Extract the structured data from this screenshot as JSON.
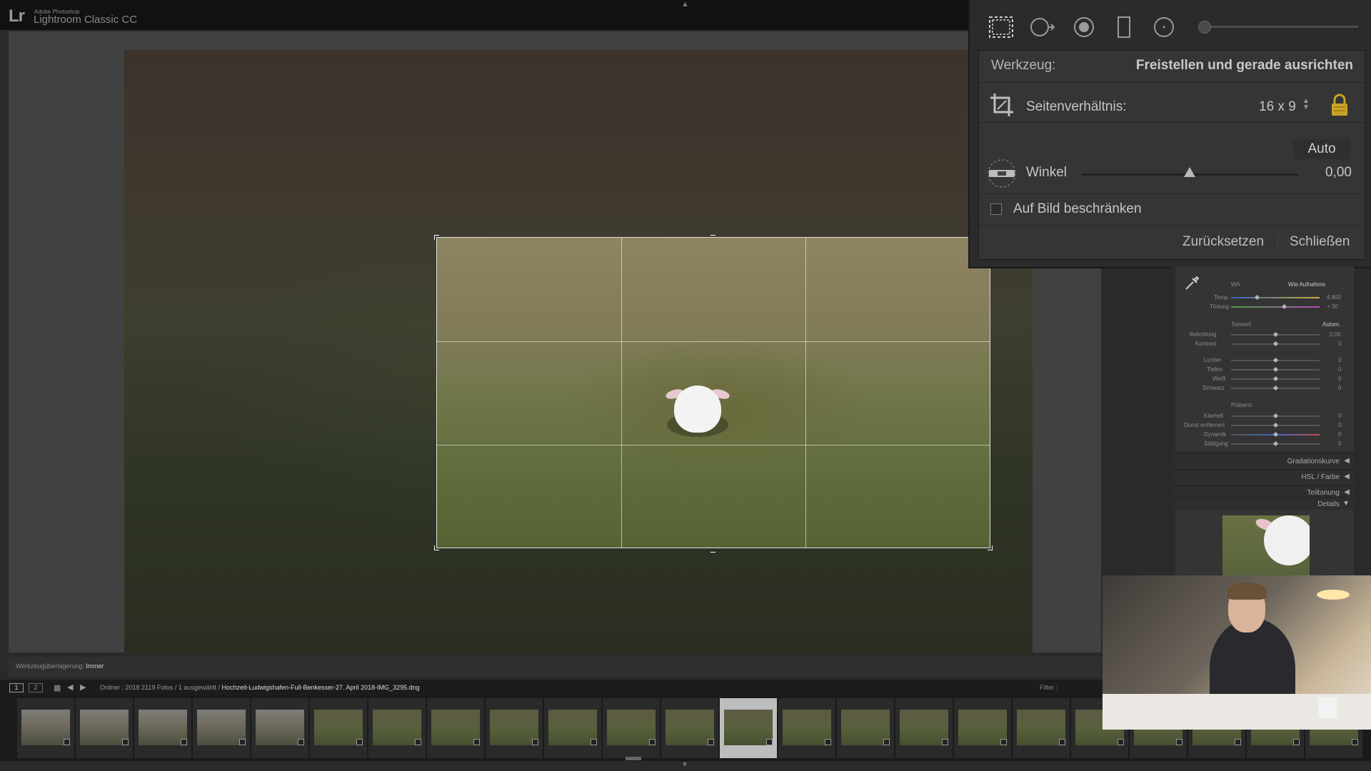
{
  "app": {
    "logo": "Lr",
    "brand_small": "Adobe Photoshop",
    "brand_name": "Lightroom Classic CC"
  },
  "icons": {
    "top_arrow": "▲",
    "bottom_arrow": "▼",
    "rotate_cursor": "⤧",
    "grid": "▦",
    "back": "◀",
    "forward": "▶"
  },
  "crop_tool": {
    "tool_label": "Werkzeug:",
    "tool_value": "Freistellen und gerade ausrichten",
    "aspect_label": "Seitenverhältnis:",
    "aspect_value": "16 x 9",
    "aspect_arrows": "▲\n▼",
    "auto_button": "Auto",
    "angle_label": "Winkel",
    "angle_value": "0,00",
    "constrain_label": "Auf Bild beschränken",
    "reset_button": "Zurücksetzen",
    "close_button": "Schließen",
    "lock_color": "#c9a325"
  },
  "develop": {
    "wb_label": "WA",
    "wb_value": "Wie Aufnahme",
    "temp_label": "Temp.",
    "temp_value": "4.800",
    "tint_label": "Tönung",
    "tint_value": "+ 30",
    "tone_label": "Tonwert",
    "tone_auto": "Autom.",
    "exposure_label": "Belichtung",
    "exposure_value": "0,00",
    "contrast_label": "Kontrast",
    "contrast_value": "0",
    "highlights_label": "Lichter",
    "highlights_value": "0",
    "shadows_label": "Tiefen",
    "shadows_value": "0",
    "whites_label": "Weiß",
    "whites_value": "0",
    "blacks_label": "Schwarz",
    "blacks_value": "0",
    "presence_label": "Präsenz",
    "clarity_label": "Klarheit",
    "clarity_value": "0",
    "dehaze_label": "Dunst entfernen",
    "dehaze_value": "0",
    "vibrance_label": "Dynamik",
    "vibrance_value": "0",
    "saturation_label": "Sättigung",
    "saturation_value": "0",
    "sections": [
      {
        "label": "Gradationskurve",
        "arrow": "◀"
      },
      {
        "label": "HSL / Farbe",
        "arrow": "◀"
      },
      {
        "label": "Teiltonung",
        "arrow": "◀"
      },
      {
        "label": "Details",
        "arrow": "▼"
      }
    ]
  },
  "toolbar": {
    "overlay_label": "Werkzeugüberlagerung:",
    "overlay_value": "Immer"
  },
  "filmstrip": {
    "screen1": "1",
    "screen2": "2",
    "breadcrumb_prefix": "Ordner : 2018   2119 Fotos /  1 ausgewählt /",
    "breadcrumb_file": "Hochzeit-Ludwigshafen-Full-Benkesser-27. April 2018-IMG_3295.dng",
    "filter_label": "Filter :",
    "thumb_count": 23,
    "selected_index": 12
  }
}
